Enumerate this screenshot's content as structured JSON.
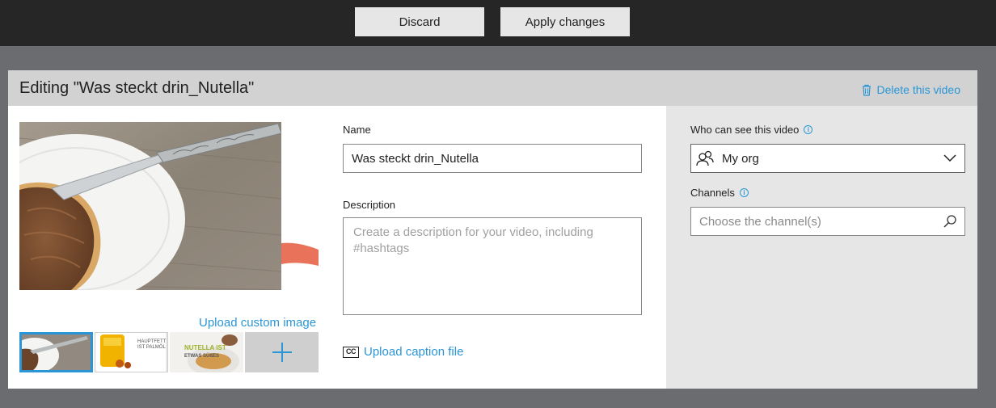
{
  "toolbar": {
    "discard_label": "Discard",
    "apply_label": "Apply changes"
  },
  "header": {
    "title": "Editing \"Was steckt drin_Nutella\"",
    "delete_label": "Delete this video",
    "delete_icon": "trash-icon"
  },
  "thumbnail": {
    "upload_custom_label": "Upload custom image",
    "options": [
      {
        "name": "frame-1",
        "selected": true
      },
      {
        "name": "frame-2",
        "text_lines": [
          "HAUPTFETT",
          "IST PALMÖL"
        ]
      },
      {
        "name": "frame-3",
        "text_lines": [
          "NUTELLA IST",
          "ETWAS SÜßES"
        ]
      }
    ],
    "add_icon": "plus-icon"
  },
  "form": {
    "name_label": "Name",
    "name_value": "Was steckt drin_Nutella",
    "description_label": "Description",
    "description_placeholder": "Create a description for your video, including #hashtags",
    "caption_icon_text": "CC",
    "caption_label": "Upload caption file"
  },
  "visibility": {
    "label": "Who can see this video",
    "selected": "My org",
    "icon": "people-icon"
  },
  "channels": {
    "label": "Channels",
    "placeholder": "Choose the channel(s)",
    "icon": "search-icon"
  },
  "colors": {
    "accent": "#2b96d6",
    "topbar": "#262626",
    "backdrop": "#6b6c70",
    "header": "#d2d2d2",
    "right_panel": "#e6e6e6"
  }
}
